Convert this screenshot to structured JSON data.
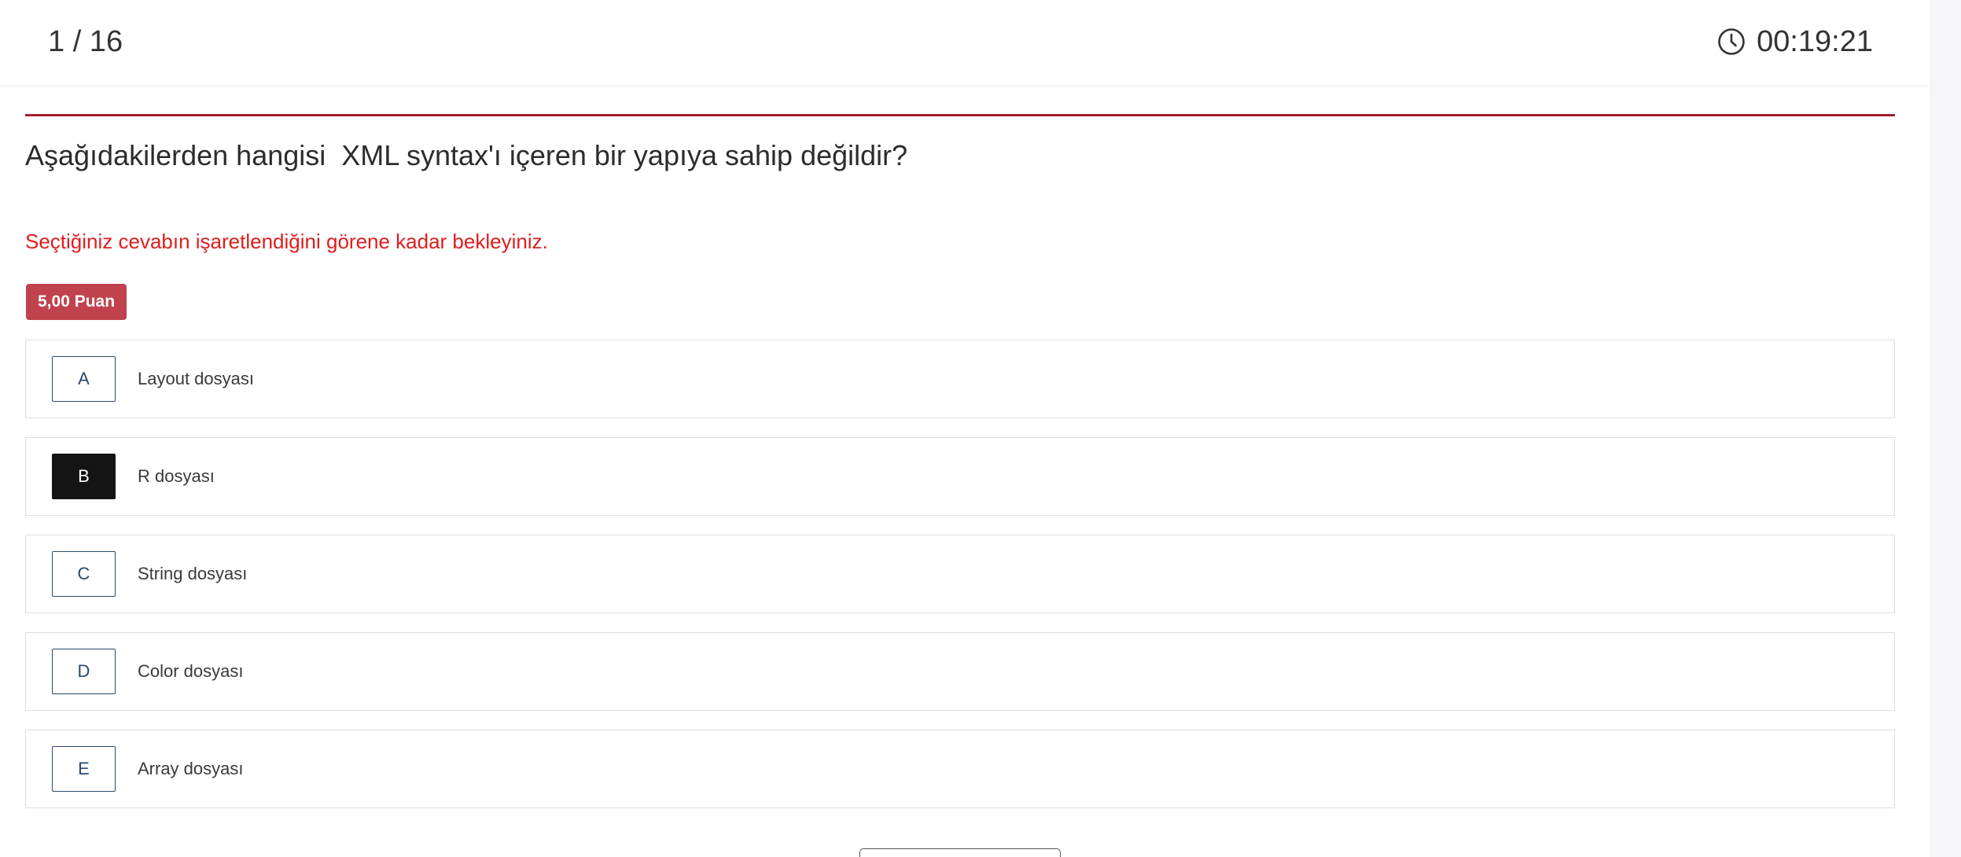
{
  "header": {
    "question_counter": "1 / 16",
    "timer": "00:19:21",
    "timer_icon": "clock-icon"
  },
  "question": {
    "text": "Aşağıdakilerden hangisi  XML syntax'ı içeren bir yapıya sahip değildir?",
    "notice": "Seçtiğiniz cevabın işaretlendiğini görene kadar bekleyiniz.",
    "points": "5,00 Puan"
  },
  "options": [
    {
      "letter": "A",
      "text": "Layout dosyası",
      "selected": false
    },
    {
      "letter": "B",
      "text": "R dosyası",
      "selected": true
    },
    {
      "letter": "C",
      "text": "String dosyası",
      "selected": false
    },
    {
      "letter": "D",
      "text": "Color dosyası",
      "selected": false
    },
    {
      "letter": "E",
      "text": "Array dosyası",
      "selected": false
    }
  ],
  "colors": {
    "accent": "#a51d2d",
    "notice": "#e11d1d",
    "badge": "#c0424d",
    "option_border": "#2b4a6b",
    "selected": "#141414"
  }
}
